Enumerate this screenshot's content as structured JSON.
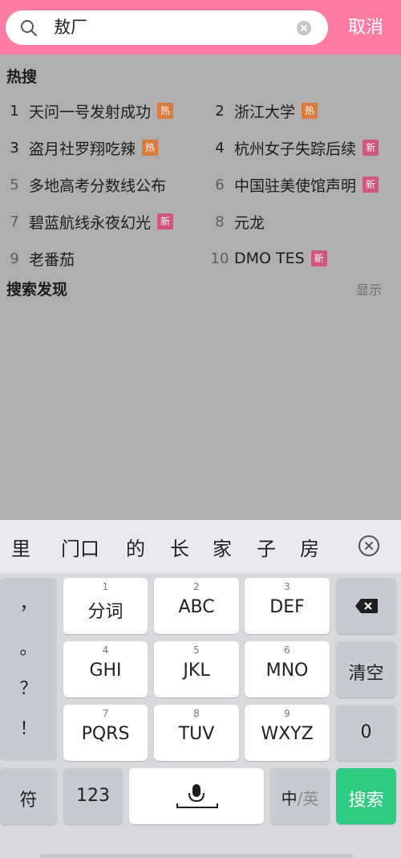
{
  "header": {
    "search_value": "敖厂",
    "cancel_label": "取消",
    "icons": {
      "search": "search-icon",
      "clear": "clear-circle-icon"
    },
    "bar_color": "#ff7da5"
  },
  "hot_search": {
    "title": "热搜",
    "items": [
      {
        "rank": "1",
        "label": "天问一号发射成功",
        "badge": "热"
      },
      {
        "rank": "2",
        "label": "浙江大学",
        "badge": "热"
      },
      {
        "rank": "3",
        "label": "盗月社罗翔吃辣",
        "badge": "热"
      },
      {
        "rank": "4",
        "label": "杭州女子失踪后续",
        "badge": "新"
      },
      {
        "rank": "5",
        "label": "多地高考分数线公布",
        "badge": ""
      },
      {
        "rank": "6",
        "label": "中国驻美使馆声明",
        "badge": "新"
      },
      {
        "rank": "7",
        "label": "碧蓝航线永夜幻光",
        "badge": "新"
      },
      {
        "rank": "8",
        "label": "元龙",
        "badge": ""
      },
      {
        "rank": "9",
        "label": "老番茄",
        "badge": ""
      },
      {
        "rank": "10",
        "label": "DMO TES",
        "badge": "新"
      }
    ]
  },
  "discover": {
    "title": "搜索发现",
    "toggle_label": "显示"
  },
  "keyboard": {
    "candidates": [
      "里",
      "门口",
      "的",
      "长",
      "家",
      "子",
      "房"
    ],
    "punctuation": [
      "，",
      "。",
      "？",
      "！"
    ],
    "keys": {
      "k1": {
        "num": "1",
        "label": "分词"
      },
      "k2": {
        "num": "2",
        "label": "ABC"
      },
      "k3": {
        "num": "3",
        "label": "DEF"
      },
      "k4": {
        "num": "4",
        "label": "GHI"
      },
      "k5": {
        "num": "5",
        "label": "JKL"
      },
      "k6": {
        "num": "6",
        "label": "MNO"
      },
      "k7": {
        "num": "7",
        "label": "PQRS"
      },
      "k8": {
        "num": "8",
        "label": "TUV"
      },
      "k9": {
        "num": "9",
        "label": "WXYZ"
      },
      "clear": "清空",
      "zero": "0",
      "symbol": "符",
      "num123": "123",
      "lang_cn": "中",
      "lang_sep": "/",
      "lang_en": "英",
      "search": "搜索"
    },
    "icons": {
      "backspace": "backspace-icon",
      "mic": "microphone-icon",
      "close_candidates": "close-circle-icon"
    },
    "search_key_color": "#2ecb83"
  }
}
